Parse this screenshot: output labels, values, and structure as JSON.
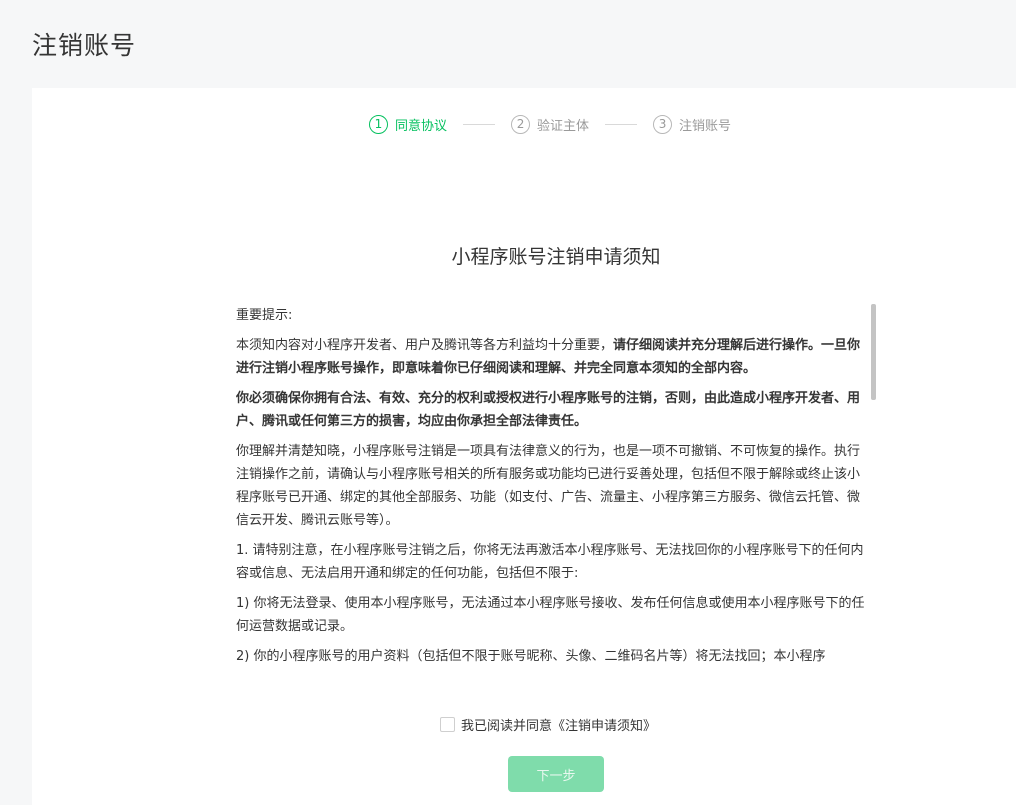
{
  "page": {
    "title": "注销账号"
  },
  "steps": [
    {
      "num": "1",
      "label": "同意协议",
      "state": "active"
    },
    {
      "num": "2",
      "label": "验证主体",
      "state": "inactive"
    },
    {
      "num": "3",
      "label": "注销账号",
      "state": "inactive"
    }
  ],
  "notice": {
    "title": "小程序账号注销申请须知",
    "heading": "重要提示:",
    "p1_normal": "本须知内容对小程序开发者、用户及腾讯等各方利益均十分重要，",
    "p1_bold": "请仔细阅读并充分理解后进行操作。一旦你进行注销小程序账号操作，即意味着你已仔细阅读和理解、并完全同意本须知的全部内容。",
    "p2_bold": "你必须确保你拥有合法、有效、充分的权利或授权进行小程序账号的注销，否则，由此造成小程序开发者、用户、腾讯或任何第三方的损害，均应由你承担全部法律责任。",
    "p3": "你理解并清楚知晓，小程序账号注销是一项具有法律意义的行为，也是一项不可撤销、不可恢复的操作。执行注销操作之前，请确认与小程序账号相关的所有服务或功能均已进行妥善处理，包括但不限于解除或终止该小程序账号已开通、绑定的其他全部服务、功能（如支付、广告、流量主、小程序第三方服务、微信云托管、微信云开发、腾讯云账号等）。",
    "p4": "1. 请特别注意，在小程序账号注销之后，你将无法再激活本小程序账号、无法找回你的小程序账号下的任何内容或信息、无法启用开通和绑定的任何功能，包括但不限于:",
    "p5": "1) 你将无法登录、使用本小程序账号，无法通过本小程序账号接收、发布任何信息或使用本小程序账号下的任何运营数据或记录。",
    "p6": "2) 你的小程序账号的用户资料（包括但不限于账号昵称、头像、二维码名片等）将无法找回；本小程序"
  },
  "agreement": {
    "label": "我已阅读并同意《注销申请须知》",
    "checked": false
  },
  "next_button": {
    "label": "下一步",
    "enabled": false
  },
  "colors": {
    "accent": "#07c160",
    "button_disabled": "#7fdcab",
    "page_bg": "#f6f7f8"
  }
}
